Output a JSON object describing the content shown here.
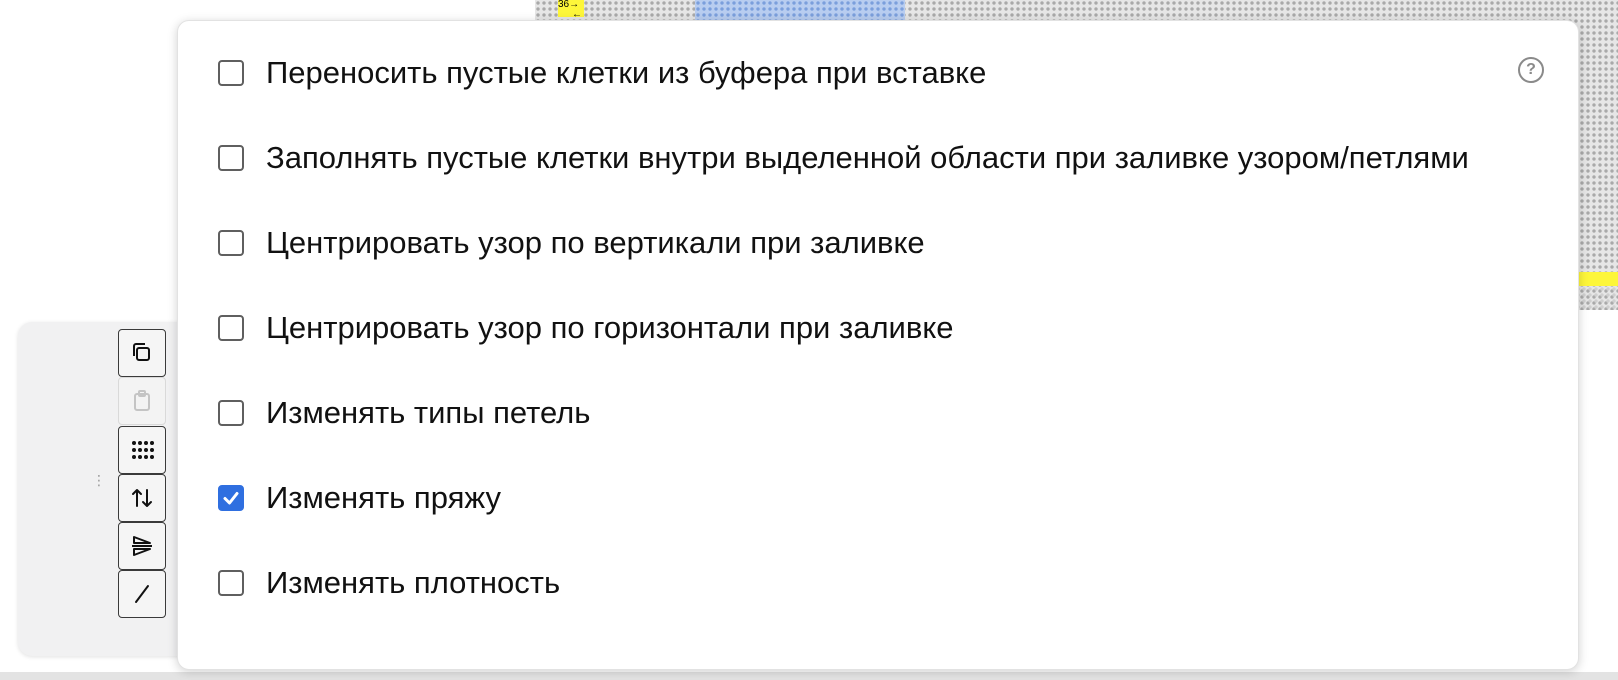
{
  "chart_header": {
    "row_number": "36",
    "arrow_right": "→",
    "arrow_left": "←"
  },
  "toolbar": {
    "drag_handle": "⋮",
    "buttons": [
      {
        "icon": "copy-icon",
        "enabled": true
      },
      {
        "icon": "paste-icon",
        "enabled": false
      },
      {
        "icon": "grid-dots-icon",
        "enabled": true
      },
      {
        "icon": "swap-vertical-icon",
        "enabled": true
      },
      {
        "icon": "mirror-icon",
        "enabled": true
      },
      {
        "icon": "slash-icon",
        "enabled": true
      }
    ]
  },
  "settings": {
    "help_label": "?",
    "options": [
      {
        "label": "Переносить пустые клетки из буфера при вставке",
        "checked": false
      },
      {
        "label": "Заполнять пустые клетки внутри выделенной области при заливке узором/петлями",
        "checked": false
      },
      {
        "label": "Центрировать узор по вертикали при заливке",
        "checked": false
      },
      {
        "label": "Центрировать узор по горизонтали при заливке",
        "checked": false
      },
      {
        "label": "Изменять типы петель",
        "checked": false
      },
      {
        "label": "Изменять пряжу",
        "checked": true
      },
      {
        "label": "Изменять плотность",
        "checked": false
      }
    ]
  },
  "colors": {
    "accent": "#2f6fe0",
    "highlight": "#fdf63a",
    "selection": "#7b9fdc"
  }
}
